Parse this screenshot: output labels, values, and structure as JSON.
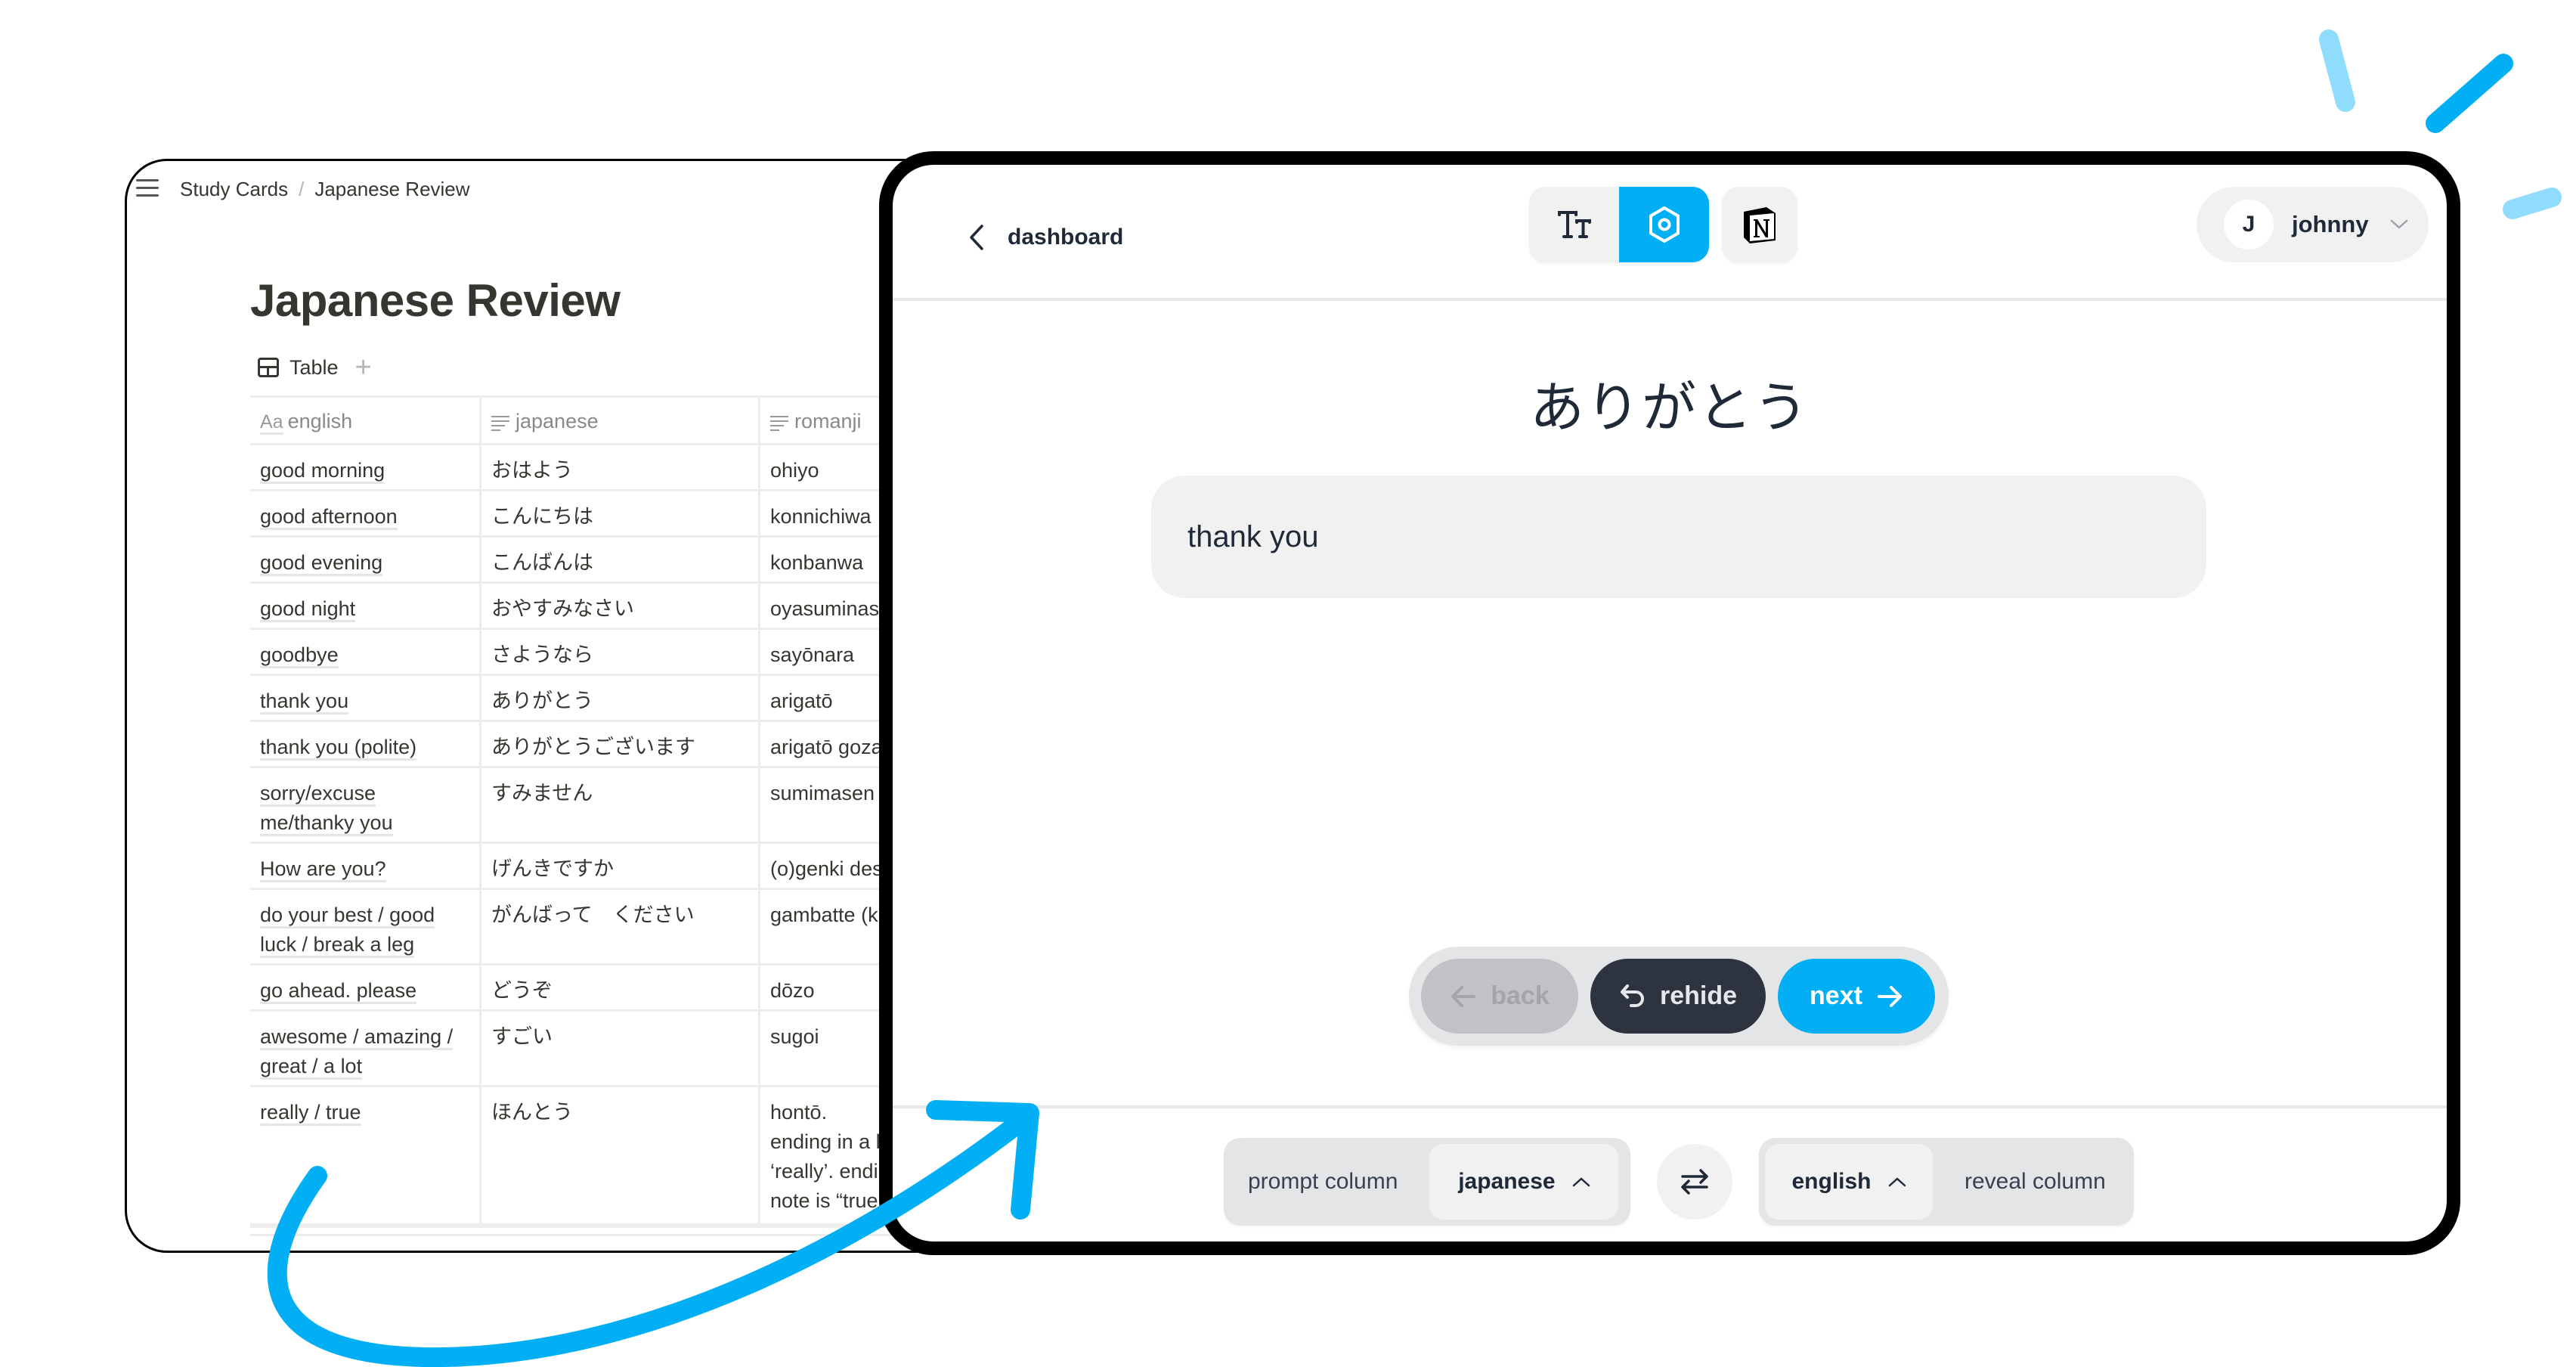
{
  "notion": {
    "breadcrumb": [
      "Study Cards",
      "Japanese Review"
    ],
    "breadcrumb_separator": "/",
    "page_title": "Japanese Review",
    "view_tab": "Table",
    "add_view": "+",
    "columns": [
      {
        "icon": "text-title-icon",
        "icon_label": "Aa",
        "label": "english"
      },
      {
        "icon": "text-lines-icon",
        "label": "japanese"
      },
      {
        "icon": "text-lines-icon",
        "label": "romanji"
      }
    ],
    "rows": [
      {
        "english": [
          "good morning"
        ],
        "japanese": "おはよう",
        "romanji": [
          "ohiyo"
        ]
      },
      {
        "english": [
          "good afternoon"
        ],
        "japanese": "こんにちは",
        "romanji": [
          "konnichiwa"
        ]
      },
      {
        "english": [
          "good evening"
        ],
        "japanese": "こんばんは",
        "romanji": [
          "konbanwa"
        ]
      },
      {
        "english": [
          "good night"
        ],
        "japanese": "おやすみなさい",
        "romanji": [
          "oyasuminasa"
        ]
      },
      {
        "english": [
          "goodbye"
        ],
        "japanese": "さようなら",
        "romanji": [
          "sayōnara"
        ]
      },
      {
        "english": [
          "thank you"
        ],
        "japanese": "ありがとう",
        "romanji": [
          "arigatō"
        ]
      },
      {
        "english": [
          "thank you (polite)"
        ],
        "japanese": "ありがとうございます",
        "romanji": [
          "arigatō goza"
        ]
      },
      {
        "english": [
          "sorry/excuse",
          "me/thanky you"
        ],
        "japanese": "すみません",
        "romanji": [
          "sumimasen"
        ]
      },
      {
        "english": [
          "How are you?"
        ],
        "japanese": "げんきですか",
        "romanji": [
          "(o)genki des"
        ]
      },
      {
        "english": [
          "do your best / good",
          "luck / break a leg"
        ],
        "japanese": "がんばって　ください",
        "romanji": [
          "gambatte (ku"
        ]
      },
      {
        "english": [
          "go ahead. please"
        ],
        "japanese": "どうぞ",
        "romanji": [
          "dōzo"
        ]
      },
      {
        "english": [
          "awesome / amazing /",
          "great / a lot"
        ],
        "japanese": "すごい",
        "romanji": [
          "sugoi"
        ]
      },
      {
        "english": [
          "really / true"
        ],
        "japanese": "ほんとう",
        "romanji": [
          "hontō.",
          "ending in a h",
          "‘really’. endin",
          "note is “true"
        ]
      }
    ]
  },
  "app": {
    "back_label": "dashboard",
    "toolbar": {
      "text_size_icon": "text-size-icon",
      "settings_icon": "hexagon-settings-icon",
      "notion_icon": "notion-logo-icon",
      "active": "settings"
    },
    "user": {
      "initial": "J",
      "name": "johnny"
    },
    "card": {
      "prompt": "ありがとう",
      "answer": "thank you"
    },
    "nav": {
      "back_label": "back",
      "back_enabled": false,
      "rehide_label": "rehide",
      "next_label": "next"
    },
    "columns": {
      "prompt_label": "prompt column",
      "prompt_value": "japanese",
      "reveal_value": "english",
      "reveal_label": "reveal column"
    }
  },
  "colors": {
    "accent": "#03aff4",
    "accent_light": "#8fdcfc",
    "dark_button": "#2e3340",
    "frame": "#000000"
  }
}
